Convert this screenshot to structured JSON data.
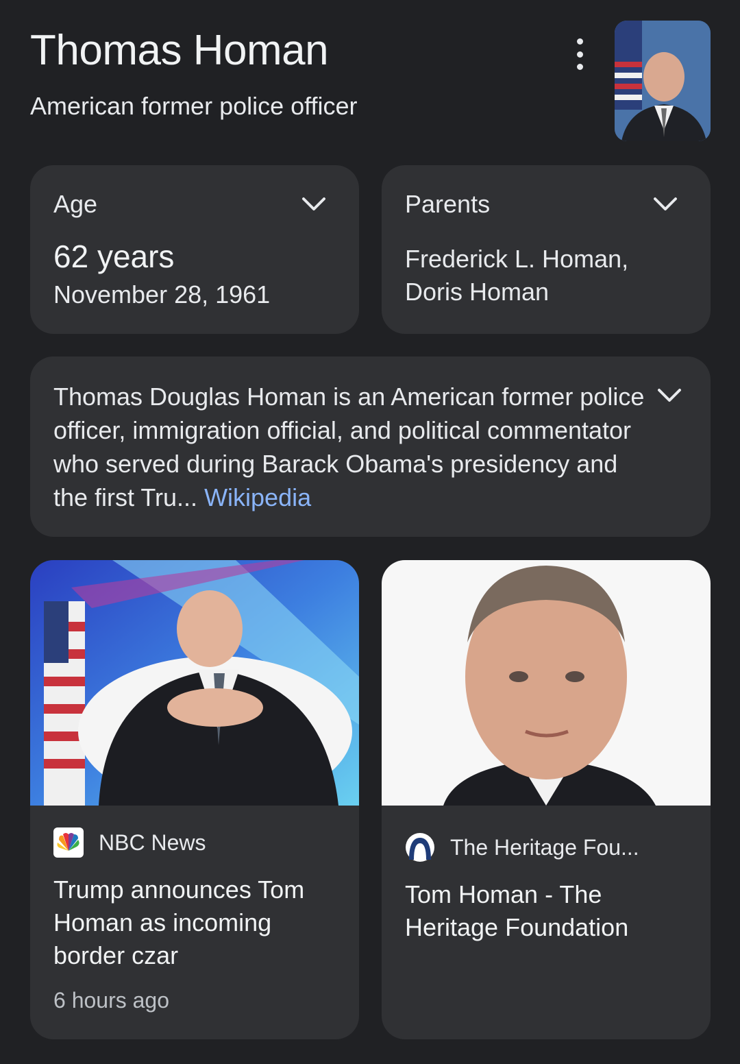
{
  "header": {
    "title": "Thomas Homan",
    "subtitle": "American former police officer"
  },
  "facts": {
    "age": {
      "label": "Age",
      "value": "62 years",
      "date": "November 28, 1961"
    },
    "parents": {
      "label": "Parents",
      "line1": "Frederick L. Homan,",
      "line2": "Doris Homan"
    }
  },
  "description": {
    "text": "Thomas Douglas Homan is an American former police officer, immigration official, and political commentator who served during Barack Obama's presidency and the first Tru... ",
    "source": "Wikipedia"
  },
  "news": [
    {
      "source": "NBC News",
      "title": "Trump announces Tom Homan as incoming border czar",
      "time": "6 hours ago"
    },
    {
      "source": "The Heritage Fou...",
      "title": "Tom Homan - The Heritage Foundation"
    }
  ],
  "colors": {
    "background": "#202124",
    "card": "#303134",
    "link": "#8ab4f8",
    "text": "#e8eaed"
  },
  "icons": {
    "more": "more-vert-icon",
    "expand": "chevron-down-icon",
    "nbc": "nbc-peacock-logo",
    "heritage": "heritage-bell-logo"
  }
}
